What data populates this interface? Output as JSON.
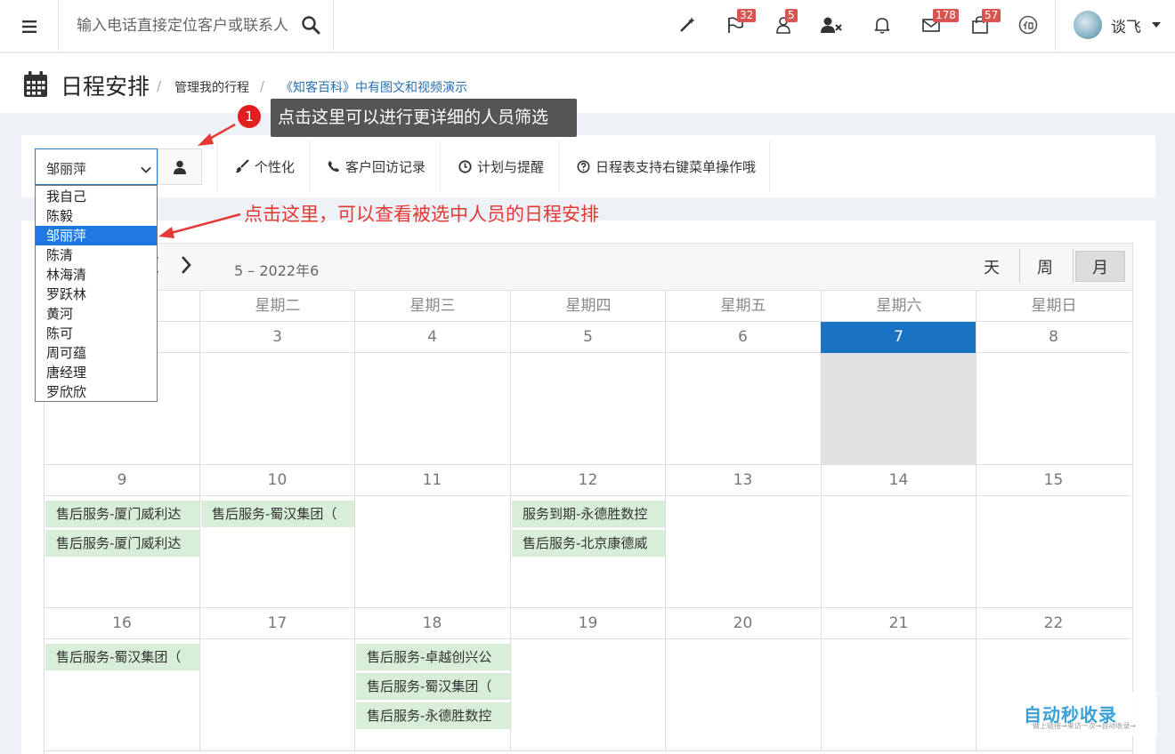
{
  "topbar": {
    "search_placeholder": "输入电话直接定位客户或联系人",
    "badges": {
      "flag": "32",
      "user": "5",
      "mail": "178",
      "bag": "57"
    },
    "username": "谈飞"
  },
  "header": {
    "title": "日程安排",
    "breadcrumb_sep": "/",
    "breadcrumb_1": "管理我的行程",
    "breadcrumb_2": "《知客百科》中有图文和视频演示"
  },
  "annotations": {
    "step_number": "1",
    "tooltip": "点击这里可以进行更详细的人员筛选",
    "hint": "点击这里，可以查看被选中人员的日程安排"
  },
  "filter": {
    "selected_person": "邹丽萍",
    "options": [
      "我自己",
      "陈毅",
      "邹丽萍",
      "陈清",
      "林海清",
      "罗跃林",
      "黄河",
      "陈可",
      "周可蕴",
      "唐经理",
      "罗欣欣"
    ],
    "toolbar": [
      "个性化",
      "客户回访记录",
      "计划与提醒",
      "日程表支持右键菜单操作哦"
    ]
  },
  "calendar": {
    "range_label": "5 – 2022年6",
    "views": [
      "天",
      "周",
      "月"
    ],
    "active_view": "月",
    "weekdays": [
      "",
      "星期二",
      "星期三",
      "星期四",
      "星期五",
      "星期六",
      "星期日"
    ],
    "weeks": [
      {
        "days": [
          "",
          "3",
          "4",
          "5",
          "6",
          "7",
          "8"
        ]
      },
      {
        "days": [
          "9",
          "10",
          "11",
          "12",
          "13",
          "14",
          "15"
        ]
      },
      {
        "days": [
          "16",
          "17",
          "18",
          "19",
          "20",
          "21",
          "22"
        ]
      }
    ],
    "today": "7",
    "events": {
      "d9": [
        "售后服务-厦门威利达",
        "售后服务-厦门威利达"
      ],
      "d10": [
        "售后服务-蜀汉集团（"
      ],
      "d12": [
        "服务到期-永德胜数控",
        "售后服务-北京康德威"
      ],
      "d16": [
        "售后服务-蜀汉集团（"
      ],
      "d18": [
        "售后服务-卓越创兴公",
        "售后服务-蜀汉集团（",
        "售后服务-永德胜数控"
      ]
    }
  },
  "watermark": {
    "main": "自动秒收录",
    "sub": "做上链接→来访一次→自动收录→"
  },
  "colors": {
    "accent": "#1a72c2",
    "event_bg": "#d8eed8",
    "badge": "#d9534f",
    "annotation": "#e53935"
  }
}
